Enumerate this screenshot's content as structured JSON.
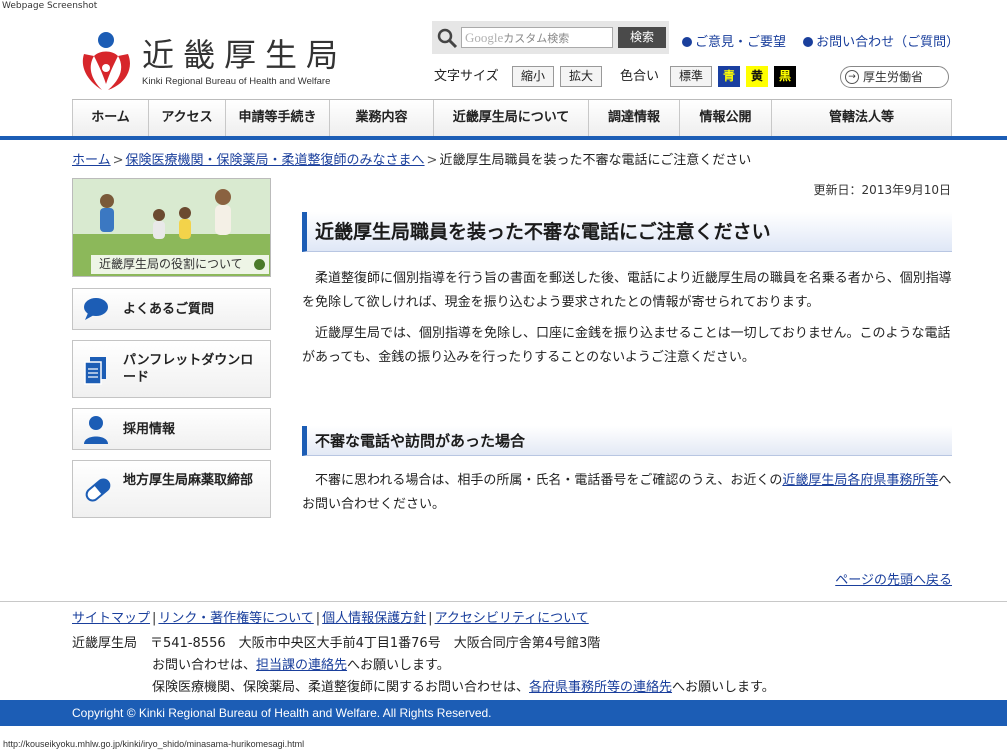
{
  "screenshot_label": "Webpage Screenshot",
  "header": {
    "logo_jp": "近畿厚生局",
    "logo_en": "Kinki Regional Bureau of Health and Welfare",
    "search": {
      "placeholder_brand": "Google",
      "placeholder_text": "カスタム検索",
      "button": "検索"
    },
    "links": [
      "ご意見・ご要望",
      "お問い合わせ（ご質問）"
    ],
    "font_size_label": "文字サイズ",
    "font_size_buttons": [
      "縮小",
      "拡大"
    ],
    "color_label": "色合い",
    "color_buttons": [
      {
        "label": "標準",
        "bg": "#f4f4f4",
        "fg": "#222222"
      },
      {
        "label": "青",
        "bg": "#1a3fa0",
        "fg": "#ffff00"
      },
      {
        "label": "黄",
        "bg": "#ffff00",
        "fg": "#111111"
      },
      {
        "label": "黒",
        "bg": "#000000",
        "fg": "#ffff00"
      }
    ],
    "mhlw_link": "厚生労働省"
  },
  "nav": [
    "ホーム",
    "アクセス",
    "申請等手続き",
    "業務内容",
    "近畿厚生局について",
    "調達情報",
    "情報公開",
    "管轄法人等"
  ],
  "breadcrumb": {
    "home": "ホーム",
    "parent": "保険医療機関・保険薬局・柔道整復師のみなさまへ",
    "current": "近畿厚生局職員を装った不審な電話にご注意ください",
    "separator": ">"
  },
  "sidebar": {
    "banner_caption": "近畿厚生局の役割について",
    "buttons": [
      {
        "label": "よくあるご質問",
        "icon": "speech-bubble-icon"
      },
      {
        "label": "パンフレットダウンロード",
        "icon": "document-stack-icon"
      },
      {
        "label": "採用情報",
        "icon": "person-icon"
      },
      {
        "label": "地方厚生局麻薬取締部",
        "icon": "capsule-icon"
      }
    ]
  },
  "main": {
    "updated": "更新日：2013年9月10日",
    "title": "近畿厚生局職員を装った不審な電話にご注意ください",
    "para1": "　柔道整復師に個別指導を行う旨の書面を郵送した後、電話により近畿厚生局の職員を名乗る者から、個別指導を免除して欲しければ、現金を振り込むよう要求されたとの情報が寄せられております。",
    "para2": "　近畿厚生局では、個別指導を免除し、口座に金銭を振り込ませることは一切しておりません。このような電話があっても、金銭の振り込みを行ったりすることのないようご注意ください。",
    "subtitle": "不審な電話や訪問があった場合",
    "para3_before": "　不審に思われる場合は、相手の所属・氏名・電話番号をご確認のうえ、お近くの",
    "para3_link": "近畿厚生局各府県事務所等",
    "para3_after": "へお問い合わせください。",
    "pagetop": "ページの先頭へ戻る"
  },
  "footer": {
    "links": [
      "サイトマップ",
      "リンク・著作権等について",
      "個人情報保護方針",
      "アクセシビリティについて"
    ],
    "org": "近畿厚生局",
    "address": "〒541-8556　大阪市中央区大手前4丁目1番76号　大阪合同庁舎第4号館3階",
    "contact1_before": "お問い合わせは、",
    "contact1_link": "担当課の連絡先",
    "contact1_after": "へお願いします。",
    "contact2_before": "保険医療機関、保険薬局、柔道整復師に関するお問い合わせは、",
    "contact2_link": "各府県事務所等の連絡先",
    "contact2_after": "へお願いします。",
    "copyright": "Copyright © Kinki Regional Bureau of Health and Welfare. All Rights Reserved.",
    "url": "http://kouseikyoku.mhlw.go.jp/kinki/iryo_shido/minasama-hurikomesagi.html"
  },
  "colors": {
    "accent": "#1c5db5",
    "link": "#1a3f9c",
    "logo_red": "#d7262b",
    "logo_blue": "#1c5db5"
  }
}
